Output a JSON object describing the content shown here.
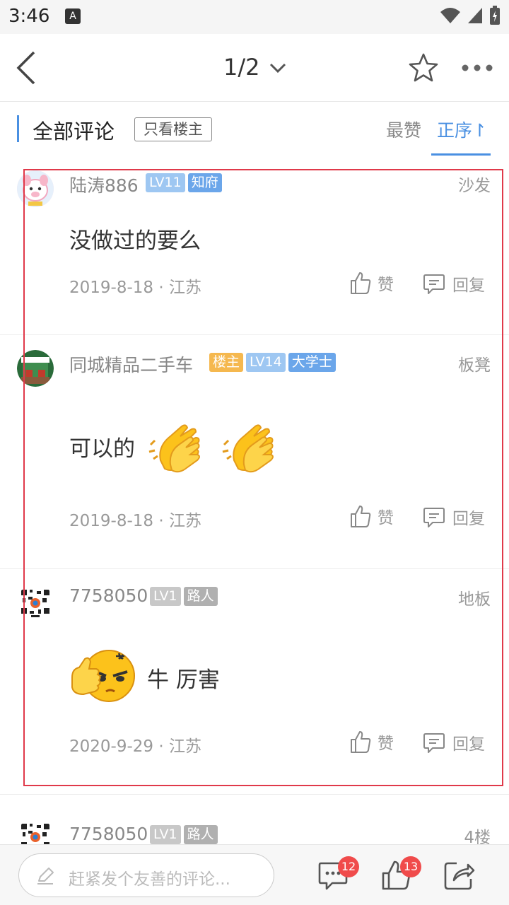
{
  "status": {
    "time": "3:46",
    "a_icon": "A"
  },
  "nav": {
    "title": "1/2"
  },
  "filter": {
    "title": "全部评论",
    "owner_only": "只看楼主",
    "hot": "最赞",
    "order": "正序↾"
  },
  "comments": [
    {
      "name": "陆涛886",
      "badges": [
        {
          "label": "LV11",
          "color": "#9ec7f2"
        },
        {
          "label": "知府",
          "color": "#6ba6ea"
        }
      ],
      "floor": "沙发",
      "text": "没做过的要么",
      "date": "2019-8-18 · 江苏",
      "like_label": "赞",
      "reply_label": "回复"
    },
    {
      "name": "同城精品二手车",
      "badges": [
        {
          "label": "楼主",
          "color": "#f5b84f"
        },
        {
          "label": "LV14",
          "color": "#9ec7f2"
        },
        {
          "label": "大学士",
          "color": "#6ba6ea"
        }
      ],
      "floor": "板凳",
      "text": "可以的",
      "emoji_1": "clapping-hands",
      "emoji_2": "clapping-hands",
      "date": "2019-8-18 · 江苏",
      "like_label": "赞",
      "reply_label": "回复"
    },
    {
      "name": "7758050",
      "badges": [
        {
          "label": "LV1",
          "color": "#c8c8c8"
        },
        {
          "label": "路人",
          "color": "#b0b0b0"
        }
      ],
      "floor": "地板",
      "text": "牛  厉害",
      "emoji_1": "thumbs-up-face",
      "date": "2020-9-29 · 江苏",
      "like_label": "赞",
      "reply_label": "回复"
    },
    {
      "name": "7758050",
      "badges": [
        {
          "label": "LV1",
          "color": "#c8c8c8"
        },
        {
          "label": "路人",
          "color": "#b0b0b0"
        }
      ],
      "floor": "4楼"
    }
  ],
  "bottom": {
    "placeholder": "赶紧发个友善的评论...",
    "comment_count": "12",
    "like_count": "13"
  },
  "colors": {
    "accent": "#4a90e2",
    "highlight": "#e0394a",
    "badge_red": "#f04b4b"
  }
}
